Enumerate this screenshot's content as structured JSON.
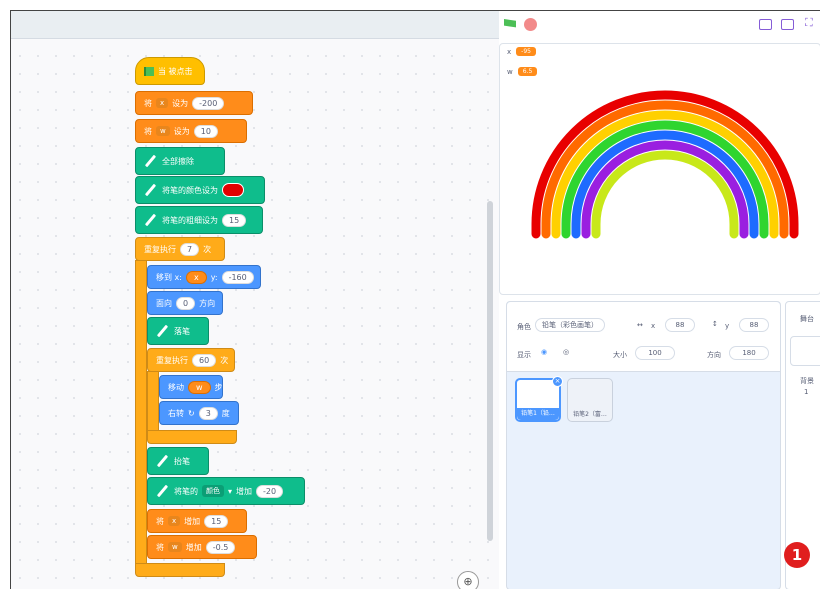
{
  "code": {
    "hat_label": "当 被点击",
    "set_x": {
      "cmd": "将",
      "var": "x",
      "to": "设为",
      "value": "-200"
    },
    "set_w": {
      "cmd": "将",
      "var": "w",
      "to": "设为",
      "value": "10"
    },
    "pen_clear": "全部擦除",
    "pen_color": "将笔的颜色设为",
    "pen_size": {
      "label": "将笔的粗细设为",
      "value": "15"
    },
    "repeat_outer": {
      "label": "重复执行",
      "times": "7",
      "suffix": "次"
    },
    "goto": {
      "label": "移到 x:",
      "x_reporter": "x",
      "y_label": "y:",
      "y_value": "-160"
    },
    "point": {
      "label": "面向",
      "value": "0",
      "suffix": "方向"
    },
    "pen_down": "落笔",
    "repeat_inner": {
      "label": "重复执行",
      "times": "60",
      "suffix": "次"
    },
    "move": {
      "label": "移动",
      "reporter": "w",
      "suffix": "步"
    },
    "turn": {
      "label": "右转",
      "value": "3",
      "suffix": "度"
    },
    "pen_up": "抬笔",
    "change_pen": {
      "label": "将笔的",
      "param": "颜色",
      "by": "增加",
      "value": "-20"
    },
    "change_x": {
      "cmd": "将",
      "var": "x",
      "by": "增加",
      "value": "15"
    },
    "change_w": {
      "cmd": "将",
      "var": "w",
      "by": "增加",
      "value": "-0.5"
    },
    "zoom_icon": "zoom-in-icon"
  },
  "stage": {
    "monitors": [
      {
        "name": "x",
        "value": "-95"
      },
      {
        "name": "w",
        "value": "6.5"
      }
    ],
    "rainbow_colors": [
      "#e80000",
      "#ff6a00",
      "#ffd000",
      "#2fd52f",
      "#1e6bff",
      "#9a1fe0",
      "#c8e81a"
    ]
  },
  "sprite_info": {
    "sprite_label": "角色",
    "sprite_name": "铅笔（彩色画笔）",
    "x_label": "x",
    "x_value": "88",
    "y_label": "y",
    "y_value": "88",
    "show_label": "显示",
    "size_label": "大小",
    "size_value": "100",
    "direction_label": "方向",
    "direction_value": "180"
  },
  "sprites": [
    {
      "name": "铅笔1（铅…",
      "selected": true
    },
    {
      "name": "铅笔2（富…",
      "selected": false
    }
  ],
  "stage_pane": {
    "title": "舞台",
    "backdrops_label": "背景",
    "backdrops_count": "1"
  },
  "annotation": "1"
}
